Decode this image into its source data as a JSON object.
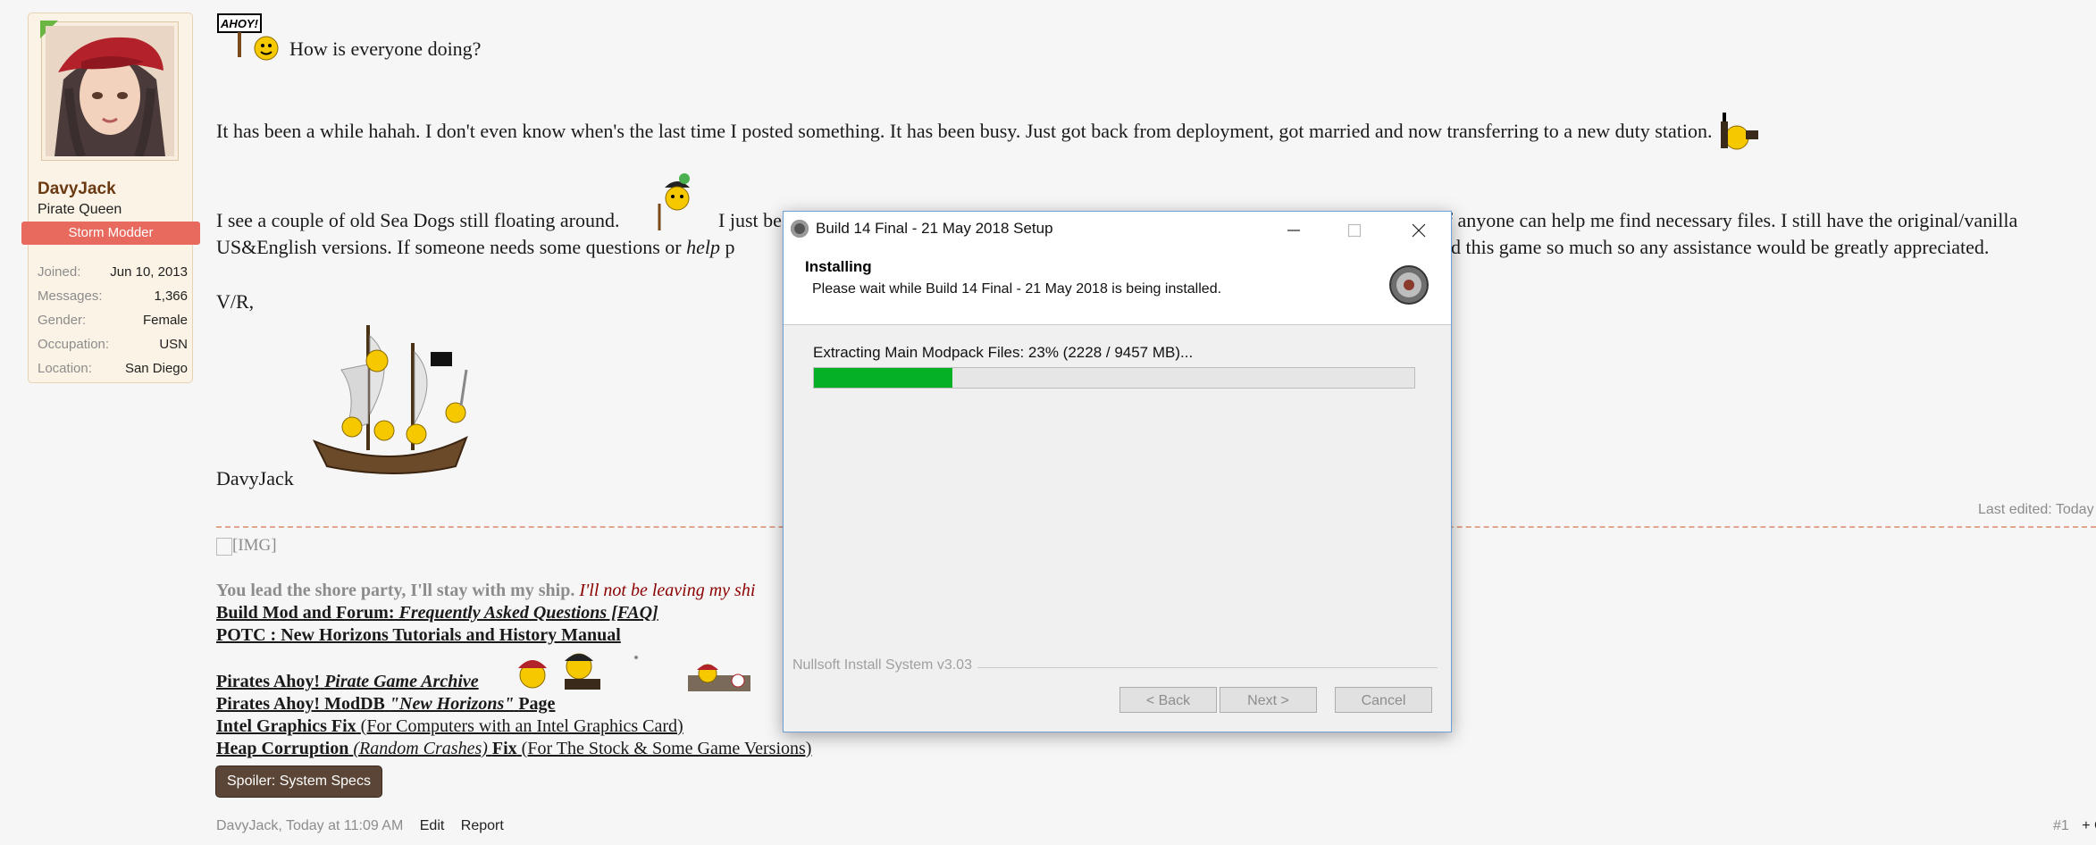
{
  "user": {
    "name": "DavyJack",
    "title": "Pirate Queen",
    "banner": "Storm Modder",
    "stats": [
      {
        "key": "Joined:",
        "value": "Jun 10, 2013"
      },
      {
        "key": "Messages:",
        "value": "1,366"
      },
      {
        "key": "Gender:",
        "value": "Female"
      },
      {
        "key": "Occupation:",
        "value": "USN"
      },
      {
        "key": "Location:",
        "value": "San Diego"
      }
    ]
  },
  "post": {
    "sign_label": "AHOY!",
    "greeting": "How is everyone doing?",
    "para1": "It has been a while hahah. I don't even know when's the last time I posted something. It has been busy. Just got back from deployment, got married and now transferring to a new duty station.",
    "para2_a": "I see a couple of old Sea Dogs still floating around.",
    "para2_b": "I just be",
    "para2_c": "g if anyone can help me find necessary files. I still have the original/vanilla",
    "para3_a": "US&English versions. If someone needs some questions or",
    "para3_help": "help",
    "para3_b": "p",
    "para3_c": "d this game so much so any assistance would be greatly appreciated.",
    "closing": "V/R,",
    "signature_name": "DavyJack",
    "last_edited": "Last edited: Today"
  },
  "signature": {
    "img_alt": "[IMG]",
    "motto_gray": "You lead the shore party, I'll stay with my ship.",
    "motto_red": "I'll not be leaving my shi",
    "link1_a": "Build Mod and Forum:",
    "link1_b": "Frequently Asked Questions [FAQ]",
    "link2": "POTC : New Horizons Tutorials and History Manual",
    "link3_a": "Pirates Ahoy!",
    "link3_b": "Pirate Game Archive",
    "link4_a": "Pirates Ahoy! ModDB",
    "link4_b": "\"New Horizons\"",
    "link4_c": "Page",
    "link5_a": "Intel Graphics Fix",
    "link5_b": "(For Computers with an Intel Graphics Card)",
    "link6_a": "Heap Corruption",
    "link6_b": "(Random Crashes)",
    "link6_c": "Fix",
    "link6_d": "(For The Stock & Some Game Versions)",
    "spoiler": "Spoiler: System Specs"
  },
  "footer": {
    "meta": "DavyJack, Today at 11:09 AM",
    "edit": "Edit",
    "report": "Report",
    "post_number": "#1",
    "extra": "+ C"
  },
  "dialog": {
    "title": "Build 14 Final - 21 May 2018 Setup",
    "heading": "Installing",
    "subheading": "Please wait while Build 14 Final - 21 May 2018 is being installed.",
    "status": "Extracting Main Modpack Files: 23% (2228 / 9457 MB)...",
    "progress": 0.23,
    "brand": "Nullsoft Install System v3.03",
    "back": "< Back",
    "next": "Next >",
    "cancel": "Cancel",
    "progress_color": "#06b025"
  }
}
